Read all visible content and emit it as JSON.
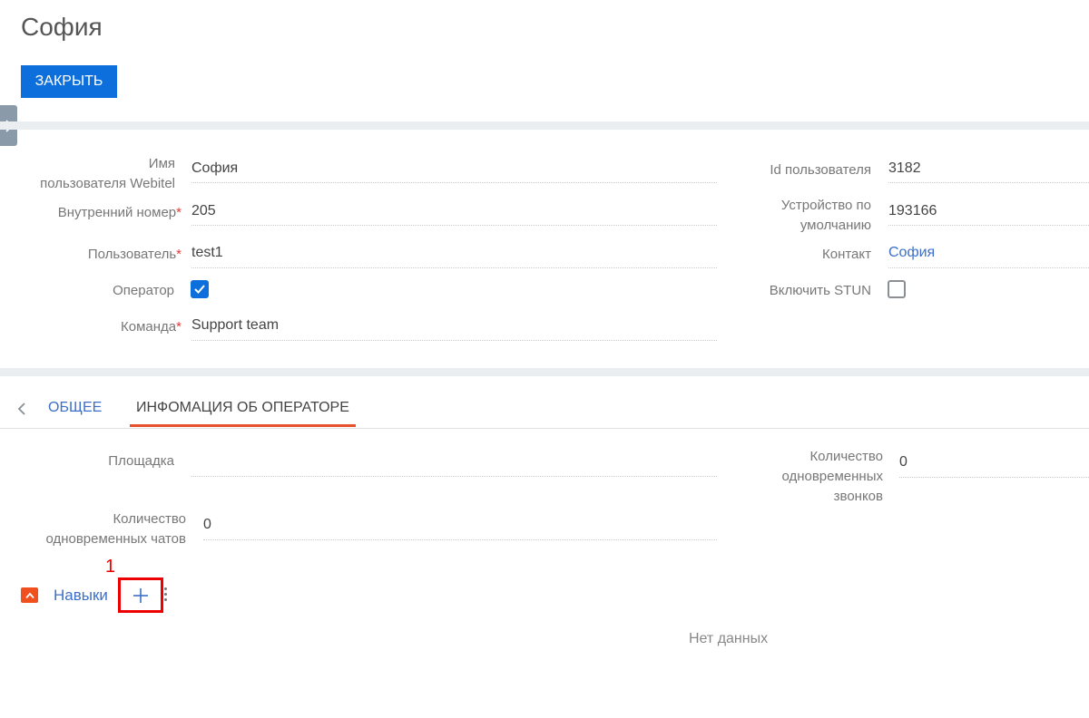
{
  "page": {
    "title": "София"
  },
  "header": {
    "close_label": "ЗАКРЫТЬ"
  },
  "colors": {
    "accent": "#0d6fdc",
    "link": "#3c6fc9",
    "required": "#e53935",
    "tab_active": "#e8502b",
    "annotation": "#ee0000"
  },
  "fields_left": [
    {
      "label_lines": [
        "Имя",
        "пользователя Webitel"
      ],
      "value": "София",
      "required": false
    },
    {
      "label": "Внутренний номер",
      "value": "205",
      "required": true
    },
    {
      "label": "Пользователь",
      "value": "test1",
      "required": true
    },
    {
      "label": "Оператор",
      "checked": true
    },
    {
      "label": "Команда",
      "value": "Support team",
      "required": true
    }
  ],
  "fields_right": [
    {
      "label": "Id пользователя",
      "value": "3182"
    },
    {
      "label_lines": [
        "Устройство по",
        "умолчанию"
      ],
      "value": "193166"
    },
    {
      "label": "Контакт",
      "value": "София",
      "is_link": true
    },
    {
      "label": "Включить STUN",
      "checked": false
    }
  ],
  "tabs": [
    {
      "label": "ОБЩЕЕ",
      "active": false
    },
    {
      "label": "ИНФОМАЦИЯ ОБ ОПЕРАТОРЕ",
      "active": true
    }
  ],
  "operator_info": {
    "site_label": "Площадка",
    "site_value": "",
    "calls_label_lines": [
      "Количество",
      "одновременных",
      "звонков"
    ],
    "calls_value": "0",
    "chats_label_lines": [
      "Количество",
      "одновременных чатов"
    ],
    "chats_value": "0"
  },
  "skills": {
    "title": "Навыки",
    "annotation": "1",
    "empty_text": "Нет данных",
    "icons": [
      "chevron-up-icon",
      "plus-icon",
      "more-vertical-icon"
    ]
  }
}
